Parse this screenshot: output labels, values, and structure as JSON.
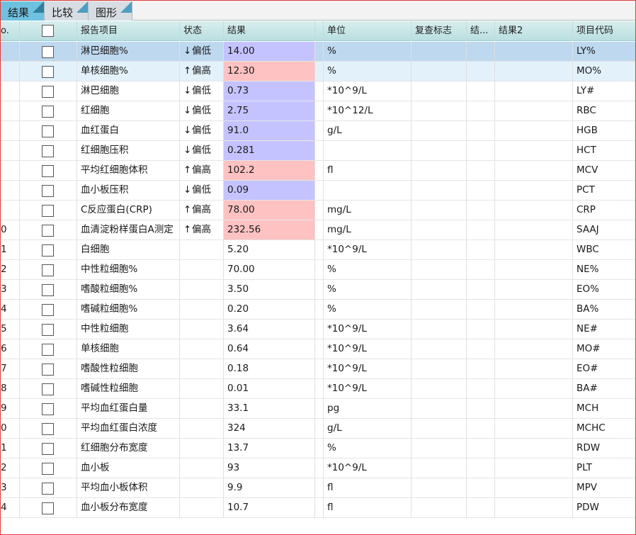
{
  "tabs": [
    {
      "label": "结果",
      "active": true
    },
    {
      "label": "比较",
      "active": false
    },
    {
      "label": "图形",
      "active": false
    }
  ],
  "columns": {
    "no": "o.",
    "item": "报告项目",
    "status": "状态",
    "result": "结果",
    "unit": "单位",
    "recheck": "复查标志",
    "result_trunc": "结...",
    "result2": "结果2",
    "code": "项目代码"
  },
  "status_labels": {
    "low": "偏低",
    "high": "偏高"
  },
  "status_arrows": {
    "low": "↓",
    "high": "↑"
  },
  "colors": {
    "low_bg": "#c5c3ff",
    "high_bg": "#ffc2c2",
    "selected_row": "#bed8ef",
    "header": "#b9dfe0"
  },
  "rows": [
    {
      "no": "",
      "item": "淋巴细胞%",
      "status": "low",
      "result": "14.00",
      "unit": "%",
      "code": "LY%"
    },
    {
      "no": "",
      "item": "单核细胞%",
      "status": "high",
      "result": "12.30",
      "unit": "%",
      "code": "MO%"
    },
    {
      "no": "",
      "item": "淋巴细胞",
      "status": "low",
      "result": "0.73",
      "unit": "*10^9/L",
      "code": "LY#"
    },
    {
      "no": "",
      "item": "红细胞",
      "status": "low",
      "result": "2.75",
      "unit": "*10^12/L",
      "code": "RBC"
    },
    {
      "no": "",
      "item": "血红蛋白",
      "status": "low",
      "result": "91.0",
      "unit": "g/L",
      "code": "HGB"
    },
    {
      "no": "",
      "item": "红细胞压积",
      "status": "low",
      "result": "0.281",
      "unit": "",
      "code": "HCT"
    },
    {
      "no": "",
      "item": "平均红细胞体积",
      "status": "high",
      "result": "102.2",
      "unit": "fl",
      "code": "MCV"
    },
    {
      "no": "",
      "item": "血小板压积",
      "status": "low",
      "result": "0.09",
      "unit": "",
      "code": "PCT"
    },
    {
      "no": "",
      "item": "C反应蛋白(CRP)",
      "status": "high",
      "result": "78.00",
      "unit": "mg/L",
      "code": "CRP"
    },
    {
      "no": "0",
      "item": "血清淀粉样蛋白A测定",
      "status": "high",
      "result": "232.56",
      "unit": "mg/L",
      "code": "SAAJ"
    },
    {
      "no": "1",
      "item": "白细胞",
      "status": "",
      "result": "5.20",
      "unit": "*10^9/L",
      "code": "WBC"
    },
    {
      "no": "2",
      "item": "中性粒细胞%",
      "status": "",
      "result": "70.00",
      "unit": "%",
      "code": "NE%"
    },
    {
      "no": "3",
      "item": "嗜酸粒细胞%",
      "status": "",
      "result": "3.50",
      "unit": "%",
      "code": "EO%"
    },
    {
      "no": "4",
      "item": "嗜碱粒细胞%",
      "status": "",
      "result": "0.20",
      "unit": "%",
      "code": "BA%"
    },
    {
      "no": "5",
      "item": "中性粒细胞",
      "status": "",
      "result": "3.64",
      "unit": "*10^9/L",
      "code": "NE#"
    },
    {
      "no": "6",
      "item": "单核细胞",
      "status": "",
      "result": "0.64",
      "unit": "*10^9/L",
      "code": "MO#"
    },
    {
      "no": "7",
      "item": "嗜酸性粒细胞",
      "status": "",
      "result": "0.18",
      "unit": "*10^9/L",
      "code": "EO#"
    },
    {
      "no": "8",
      "item": "嗜碱性粒细胞",
      "status": "",
      "result": "0.01",
      "unit": "*10^9/L",
      "code": "BA#"
    },
    {
      "no": "9",
      "item": "平均血红蛋白量",
      "status": "",
      "result": "33.1",
      "unit": "pg",
      "code": "MCH"
    },
    {
      "no": "0",
      "item": "平均血红蛋白浓度",
      "status": "",
      "result": "324",
      "unit": "g/L",
      "code": "MCHC"
    },
    {
      "no": "1",
      "item": "红细胞分布宽度",
      "status": "",
      "result": "13.7",
      "unit": "%",
      "code": "RDW"
    },
    {
      "no": "2",
      "item": "血小板",
      "status": "",
      "result": "93",
      "unit": "*10^9/L",
      "code": "PLT"
    },
    {
      "no": "3",
      "item": "平均血小板体积",
      "status": "",
      "result": "9.9",
      "unit": "fl",
      "code": "MPV"
    },
    {
      "no": "4",
      "item": "血小板分布宽度",
      "status": "",
      "result": "10.7",
      "unit": "fl",
      "code": "PDW"
    }
  ]
}
